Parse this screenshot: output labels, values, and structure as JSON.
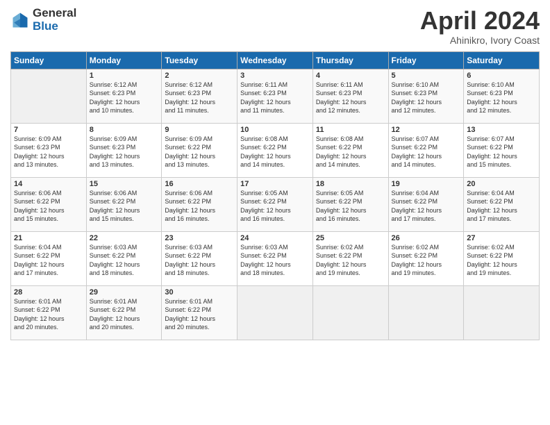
{
  "header": {
    "logo_general": "General",
    "logo_blue": "Blue",
    "title": "April 2024",
    "subtitle": "Ahinikro, Ivory Coast"
  },
  "days_of_week": [
    "Sunday",
    "Monday",
    "Tuesday",
    "Wednesday",
    "Thursday",
    "Friday",
    "Saturday"
  ],
  "weeks": [
    [
      {
        "day": "",
        "info": ""
      },
      {
        "day": "1",
        "info": "Sunrise: 6:12 AM\nSunset: 6:23 PM\nDaylight: 12 hours\nand 10 minutes."
      },
      {
        "day": "2",
        "info": "Sunrise: 6:12 AM\nSunset: 6:23 PM\nDaylight: 12 hours\nand 11 minutes."
      },
      {
        "day": "3",
        "info": "Sunrise: 6:11 AM\nSunset: 6:23 PM\nDaylight: 12 hours\nand 11 minutes."
      },
      {
        "day": "4",
        "info": "Sunrise: 6:11 AM\nSunset: 6:23 PM\nDaylight: 12 hours\nand 12 minutes."
      },
      {
        "day": "5",
        "info": "Sunrise: 6:10 AM\nSunset: 6:23 PM\nDaylight: 12 hours\nand 12 minutes."
      },
      {
        "day": "6",
        "info": "Sunrise: 6:10 AM\nSunset: 6:23 PM\nDaylight: 12 hours\nand 12 minutes."
      }
    ],
    [
      {
        "day": "7",
        "info": "Sunrise: 6:09 AM\nSunset: 6:23 PM\nDaylight: 12 hours\nand 13 minutes."
      },
      {
        "day": "8",
        "info": "Sunrise: 6:09 AM\nSunset: 6:23 PM\nDaylight: 12 hours\nand 13 minutes."
      },
      {
        "day": "9",
        "info": "Sunrise: 6:09 AM\nSunset: 6:22 PM\nDaylight: 12 hours\nand 13 minutes."
      },
      {
        "day": "10",
        "info": "Sunrise: 6:08 AM\nSunset: 6:22 PM\nDaylight: 12 hours\nand 14 minutes."
      },
      {
        "day": "11",
        "info": "Sunrise: 6:08 AM\nSunset: 6:22 PM\nDaylight: 12 hours\nand 14 minutes."
      },
      {
        "day": "12",
        "info": "Sunrise: 6:07 AM\nSunset: 6:22 PM\nDaylight: 12 hours\nand 14 minutes."
      },
      {
        "day": "13",
        "info": "Sunrise: 6:07 AM\nSunset: 6:22 PM\nDaylight: 12 hours\nand 15 minutes."
      }
    ],
    [
      {
        "day": "14",
        "info": "Sunrise: 6:06 AM\nSunset: 6:22 PM\nDaylight: 12 hours\nand 15 minutes."
      },
      {
        "day": "15",
        "info": "Sunrise: 6:06 AM\nSunset: 6:22 PM\nDaylight: 12 hours\nand 15 minutes."
      },
      {
        "day": "16",
        "info": "Sunrise: 6:06 AM\nSunset: 6:22 PM\nDaylight: 12 hours\nand 16 minutes."
      },
      {
        "day": "17",
        "info": "Sunrise: 6:05 AM\nSunset: 6:22 PM\nDaylight: 12 hours\nand 16 minutes."
      },
      {
        "day": "18",
        "info": "Sunrise: 6:05 AM\nSunset: 6:22 PM\nDaylight: 12 hours\nand 16 minutes."
      },
      {
        "day": "19",
        "info": "Sunrise: 6:04 AM\nSunset: 6:22 PM\nDaylight: 12 hours\nand 17 minutes."
      },
      {
        "day": "20",
        "info": "Sunrise: 6:04 AM\nSunset: 6:22 PM\nDaylight: 12 hours\nand 17 minutes."
      }
    ],
    [
      {
        "day": "21",
        "info": "Sunrise: 6:04 AM\nSunset: 6:22 PM\nDaylight: 12 hours\nand 17 minutes."
      },
      {
        "day": "22",
        "info": "Sunrise: 6:03 AM\nSunset: 6:22 PM\nDaylight: 12 hours\nand 18 minutes."
      },
      {
        "day": "23",
        "info": "Sunrise: 6:03 AM\nSunset: 6:22 PM\nDaylight: 12 hours\nand 18 minutes."
      },
      {
        "day": "24",
        "info": "Sunrise: 6:03 AM\nSunset: 6:22 PM\nDaylight: 12 hours\nand 18 minutes."
      },
      {
        "day": "25",
        "info": "Sunrise: 6:02 AM\nSunset: 6:22 PM\nDaylight: 12 hours\nand 19 minutes."
      },
      {
        "day": "26",
        "info": "Sunrise: 6:02 AM\nSunset: 6:22 PM\nDaylight: 12 hours\nand 19 minutes."
      },
      {
        "day": "27",
        "info": "Sunrise: 6:02 AM\nSunset: 6:22 PM\nDaylight: 12 hours\nand 19 minutes."
      }
    ],
    [
      {
        "day": "28",
        "info": "Sunrise: 6:01 AM\nSunset: 6:22 PM\nDaylight: 12 hours\nand 20 minutes."
      },
      {
        "day": "29",
        "info": "Sunrise: 6:01 AM\nSunset: 6:22 PM\nDaylight: 12 hours\nand 20 minutes."
      },
      {
        "day": "30",
        "info": "Sunrise: 6:01 AM\nSunset: 6:22 PM\nDaylight: 12 hours\nand 20 minutes."
      },
      {
        "day": "",
        "info": ""
      },
      {
        "day": "",
        "info": ""
      },
      {
        "day": "",
        "info": ""
      },
      {
        "day": "",
        "info": ""
      }
    ]
  ]
}
